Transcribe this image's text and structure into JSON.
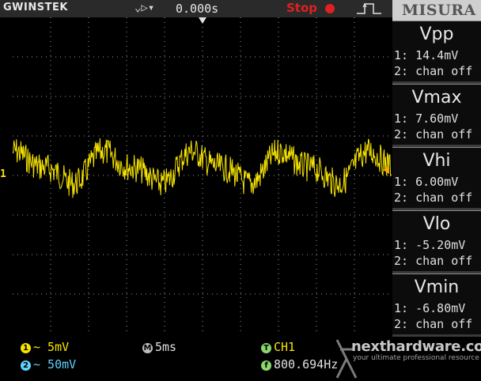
{
  "top": {
    "brand": "GWINSTEK",
    "trigger_mode": "⌄▷▾",
    "trigger_time": "0.000s",
    "run_state": "Stop",
    "panel_title": "MISURA"
  },
  "measurements": [
    {
      "name": "Vpp",
      "ch1": "1: 14.4mV",
      "ch2": "2: chan off"
    },
    {
      "name": "Vmax",
      "ch1": "1: 7.60mV",
      "ch2": "2: chan off"
    },
    {
      "name": "Vhi",
      "ch1": "1: 6.00mV",
      "ch2": "2: chan off"
    },
    {
      "name": "Vlo",
      "ch1": "1: -5.20mV",
      "ch2": "2: chan off"
    },
    {
      "name": "Vmin",
      "ch1": "1: -6.80mV",
      "ch2": "2: chan off"
    }
  ],
  "channel_marker": "1",
  "bottom": {
    "ch1_scale": "~ 5mV",
    "ch2_scale": "~ 50mV",
    "timebase": "5ms",
    "trigger_source": "CH1",
    "frequency": "800.694Hz",
    "ch1_badge": "1",
    "ch2_badge": "2",
    "timebase_badge": "M",
    "trigger_badge": "T",
    "freq_badge": "f"
  },
  "watermark": {
    "site": "nexthardware.com",
    "tagline": "your ultimate professional resource"
  },
  "colors": {
    "ch1": "#f7e400",
    "ch2": "#5fd3ff",
    "grid": "#9a9a9a",
    "panel": "#3a3a3a",
    "run_state": "#e02020"
  }
}
